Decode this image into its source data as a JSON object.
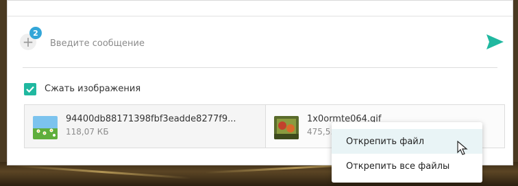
{
  "composer": {
    "attach_badge": "2",
    "placeholder": "Введите сообщение"
  },
  "options": {
    "compress_label": "Сжать изображения",
    "compress_checked": true
  },
  "attachments": [
    {
      "name": "94400db88171398fbf3eadde8277f9...",
      "size": "118,07 КБ"
    },
    {
      "name": "1x0ormte064.gif",
      "size": "475,5…"
    }
  ],
  "context_menu": {
    "items": [
      {
        "label": "Открепить файл"
      },
      {
        "label": "Открепить все файлы"
      }
    ]
  },
  "colors": {
    "accent": "#20b8a0",
    "badge": "#33a6d8",
    "menu_highlight": "#e9f4f6"
  },
  "icons": {
    "attach": "plus-icon",
    "send": "send-icon",
    "checkbox": "check-icon",
    "cursor": "mouse-pointer-icon"
  }
}
